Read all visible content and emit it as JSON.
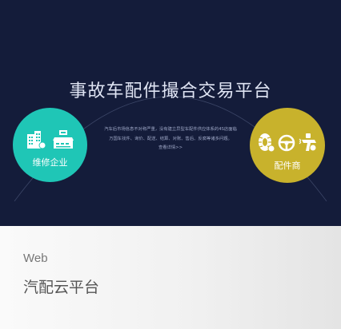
{
  "banner": {
    "headline": "事故车配件撮合交易平台",
    "description_lines": [
      "汽车后市场信息不对称严重，没有建立异型车配件供应体系的4S店面临",
      "万国车找件、询价、配送、结算、对账、售后、反腐等诸多问题。"
    ],
    "more_link": "查看详情>>",
    "left_circle_label": "维修企业",
    "right_circle_label": "配件商",
    "left_circle_color": "#1fc6b6",
    "right_circle_color": "#c8b22c",
    "background_color": "#141c3a",
    "left_icons": [
      "building-icon",
      "factory-icon"
    ],
    "right_icons": [
      "tire-icon",
      "steering-wheel-icon",
      "spray-gun-icon"
    ]
  },
  "footer": {
    "tag": "Web",
    "title": "汽配云平台"
  }
}
